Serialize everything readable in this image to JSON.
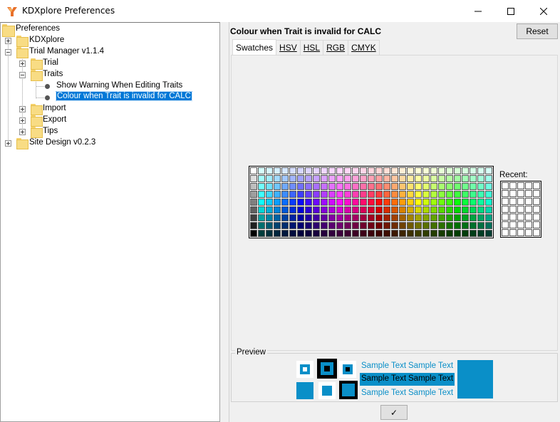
{
  "window": {
    "title": "KDXplore Preferences"
  },
  "tree": {
    "root": "Preferences",
    "kdxplore": "KDXplore",
    "trial_manager": "Trial Manager v1.1.4",
    "trial": "Trial",
    "traits": "Traits",
    "show_warning": "Show Warning When Editing Traits",
    "colour_invalid": "Colour when Trait is invalid for CALC",
    "import": "Import",
    "export": "Export",
    "tips": "Tips",
    "site_design": "Site Design v0.2.3"
  },
  "panel": {
    "heading": "Colour when Trait is invalid for CALC",
    "reset_label": "Reset",
    "tabs": [
      "Swatches",
      "HSV",
      "HSL",
      "RGB",
      "CMYK"
    ],
    "recent_label": "Recent:",
    "preview_title": "Preview",
    "sample_text": "Sample Text",
    "ok_label": "✓"
  },
  "colors": {
    "accent": "#0078d7",
    "preview_color": "#0a8fc8",
    "app_icon": "#e8702a"
  }
}
